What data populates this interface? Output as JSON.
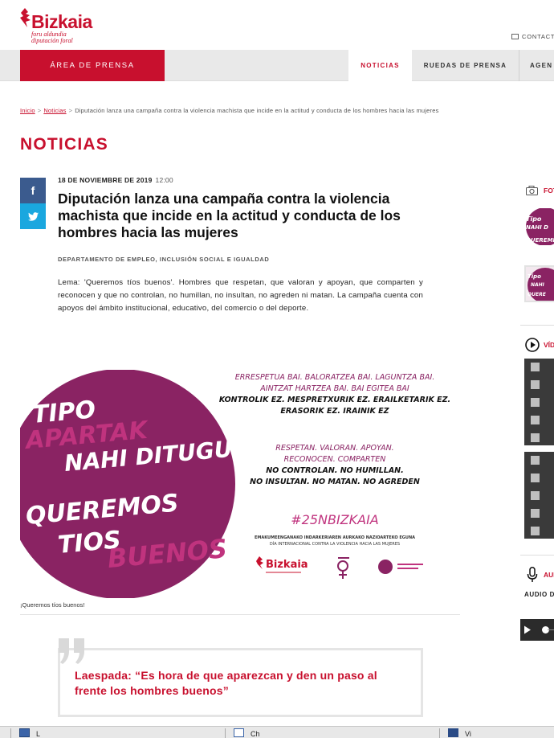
{
  "header": {
    "logo_text": "Bizkaia",
    "logo_sub_1": "foru aldundia",
    "logo_sub_2": "diputación foral",
    "contact_label": "CONTACT"
  },
  "nav": {
    "area_label": "ÁREA DE PRENSA",
    "tabs": [
      {
        "label": "NOTICIAS",
        "active": true
      },
      {
        "label": "RUEDAS DE PRENSA",
        "active": false
      },
      {
        "label": "AGEN",
        "active": false
      }
    ]
  },
  "breadcrumb": {
    "items": [
      "Inicio",
      "Noticias"
    ],
    "current": "Diputación lanza una campaña contra la violencia machista que incide en la actitud y conducta de los hombres hacia las mujeres",
    "separator": ">"
  },
  "section_title": "NOTICIAS",
  "share": {
    "facebook": "f",
    "twitter": "t"
  },
  "article": {
    "date": "18 DE NOVIEMBRE DE 2019",
    "time": "12:00",
    "headline": "Diputación lanza una campaña contra la violencia machista que incide en la actitud y conducta de los hombres hacia las mujeres",
    "department": "DEPARTAMENTO DE EMPLEO, INCLUSIÓN SOCIAL E IGUALDAD",
    "lead": "Lema: 'Queremos tíos buenos'. Hombres que respetan, que valoran y apoyan, que comparten y reconocen y que no controlan, no humillan, no insultan, no agreden ni matan. La campaña cuenta con apoyos del ámbito institucional, educativo, del comercio o del deporte.",
    "image_caption": "¡Queremos tíos buenos!",
    "quote": "Laespada: “Es hora de que aparezcan y den un paso al frente los hombres buenos”"
  },
  "campaign_image": {
    "circle_lines": [
      "TIPO",
      "APARTAK",
      "NAHI DITUGU",
      "QUEREMOS",
      "TIOS",
      "BUENOS"
    ],
    "basque_lines": [
      "ERRESPETUA BAI. BALORATZEA BAI. LAGUNTZA BAI.",
      "AINTZAT HARTZEA BAI. BAI EGITEA BAI",
      "KONTROLIK EZ. MESPRETXURIK EZ. ERAILKETARIK EZ.",
      "ERASORIK EZ. IRAINIK EZ"
    ],
    "spanish_lines": [
      "RESPETAN. VALORAN. APOYAN.",
      "RECONOCEN. COMPARTEN",
      "NO CONTROLAN. NO HUMILLAN.",
      "NO INSULTAN. NO MATAN. NO AGREDEN"
    ],
    "hashtag": "#25NBIZKAIA",
    "day_eu": "EMAKUMEENGANAKO INDARKERIAREN AURKAKO NAZIOARTEKO EGUNA",
    "day_es": "DÍA INTERNACIONAL CONTRA LA VIOLENCIA HACIA LAS MUJERES",
    "logo_text": "Bizkaia"
  },
  "sidebar": {
    "photos_label": "FOT",
    "videos_label": "VÍD",
    "audio_label": "AUD",
    "audio_text": "AUDIO D"
  },
  "taskbar": {
    "items": [
      "L",
      "Ch",
      "Vi"
    ]
  },
  "colors": {
    "brand_red": "#c8102e",
    "campaign_purple": "#8a2363",
    "facebook": "#3b5b8e",
    "twitter": "#1aa7df"
  }
}
